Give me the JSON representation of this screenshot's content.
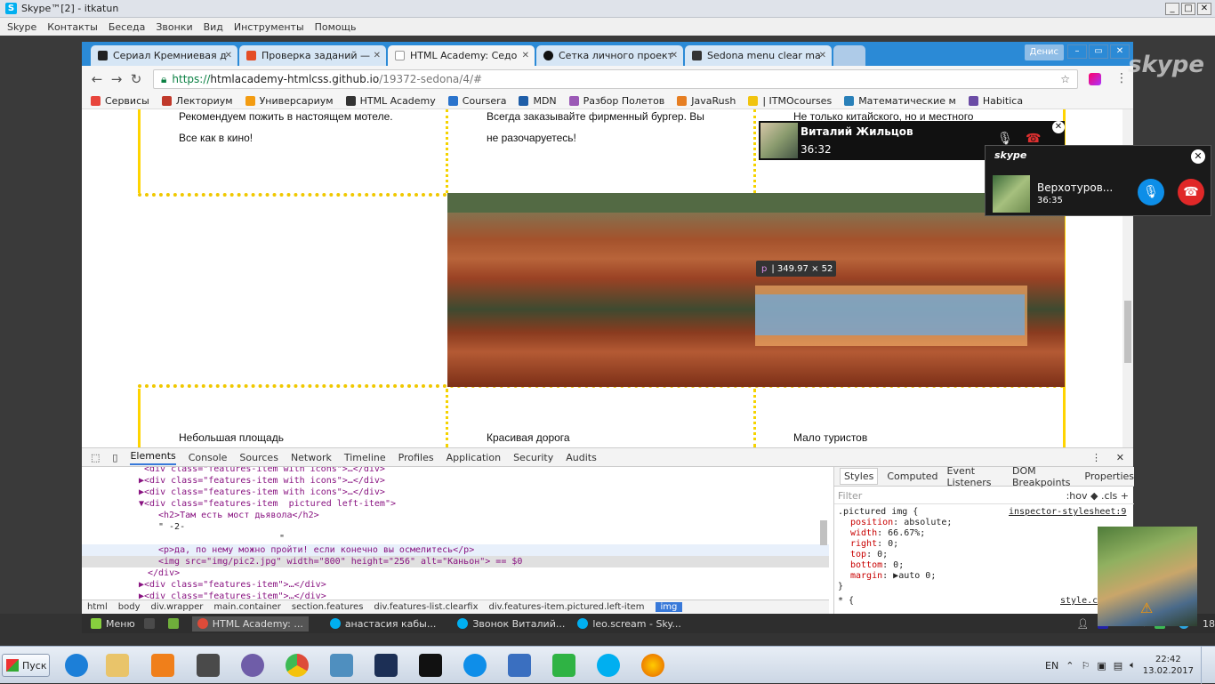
{
  "skype_window": {
    "title": "Skype™[2] - itkatun",
    "menu": [
      "Skype",
      "Контакты",
      "Беседа",
      "Звонки",
      "Вид",
      "Инструменты",
      "Помощь"
    ]
  },
  "browser": {
    "profile": "Денис",
    "tabs": [
      {
        "label": "Сериал Кремниевая д",
        "icon_color": "#222222"
      },
      {
        "label": "Проверка заданий —",
        "icon_color": "#e44d26"
      },
      {
        "label": "HTML Academy: Седо",
        "icon_color": "#555555"
      },
      {
        "label": "Сетка личного проект",
        "icon_color": "#111111"
      },
      {
        "label": "Sedona menu clear ma",
        "icon_color": "#333333"
      }
    ],
    "url": {
      "scheme": "https://",
      "host": "htmlacademy-htmlcss.github.io",
      "path": "/19372-sedona/4/#"
    },
    "bookmarks": [
      {
        "label": "Сервисы",
        "icon_color": "#e8453c"
      },
      {
        "label": "Лекториум",
        "icon_color": "#c0392b"
      },
      {
        "label": "Универсариум",
        "icon_color": "#f39c12"
      },
      {
        "label": "HTML Academy",
        "icon_color": "#333333"
      },
      {
        "label": "Coursera",
        "icon_color": "#2a73cc"
      },
      {
        "label": "MDN",
        "icon_color": "#1f5ea8"
      },
      {
        "label": "Разбор Полетов",
        "icon_color": "#9b59b6"
      },
      {
        "label": "JavaRush",
        "icon_color": "#e67e22"
      },
      {
        "label": "| ITMOcourses",
        "icon_color": "#f1c40f"
      },
      {
        "label": "Математические м",
        "icon_color": "#2980b9"
      },
      {
        "label": "Habitica",
        "icon_color": "#6b4ca5"
      }
    ]
  },
  "page": {
    "col1_text_1": "Рекомендуем пожить в настоящем мотеле.",
    "col1_text_2": "Все как в кино!",
    "col2_text_1": "Всегда заказывайте фирменный бургер. Вы",
    "col2_text_2": "не разочаруетесь!",
    "col3_text_1": "Не только китайского, но и местного",
    "bottom_1": "Небольшая площадь",
    "bottom_2": "Красивая дорога",
    "bottom_3": "Мало туристов",
    "tooltip_tag": "p",
    "tooltip_size": "| 349.97 × 52"
  },
  "devtools": {
    "tabs": [
      "Elements",
      "Console",
      "Sources",
      "Network",
      "Timeline",
      "Profiles",
      "Application",
      "Security",
      "Audits"
    ],
    "elements_lines": [
      "<div class=\"features-item with icons\">…</div>",
      "▶<div class=\"features-item with icons\">…</div>",
      "▶<div class=\"features-item with icons\">…</div>",
      "▼<div class=\"features-item  pictured left-item\">",
      "<h2>Там есть мост дьявола</h2>",
      "\" -2-",
      "\"",
      "<p>да, по нему можно пройти! если конечно вы осмелитесь</p>",
      "<img src=\"img/pic2.jpg\" width=\"800\" height=\"256\" alt=\"Каньон\"> == $0",
      "</div>",
      "▶<div class=\"features-item\">…</div>",
      "▶<div class=\"features-item\">…</div>"
    ],
    "breadcrumbs": [
      "html",
      "body",
      "div.wrapper",
      "main.container",
      "section.features",
      "div.features-list.clearfix",
      "div.features-item.pictured.left-item",
      "img"
    ],
    "styles_tabs": [
      "Styles",
      "Computed",
      "Event Listeners",
      "DOM Breakpoints",
      "Properties"
    ],
    "filter_placeholder": "Filter",
    "filter_tools": ":hov  ◆ .cls  +",
    "rule_selector": ".pictured img {",
    "rule_source": "inspector-stylesheet:9",
    "rule_lines": [
      {
        "prop": "position",
        "val": "absolute;"
      },
      {
        "prop": "width",
        "val": "66.67%;"
      },
      {
        "prop": "right",
        "val": "0;"
      },
      {
        "prop": "top",
        "val": "0;"
      },
      {
        "prop": "bottom",
        "val": "0;"
      },
      {
        "prop": "margin",
        "val": "▶auto 0;"
      }
    ],
    "rule_end": "}",
    "next_rule": "* {",
    "next_source": "style.cs"
  },
  "calls": {
    "call1_name": "Виталий Жильцов",
    "call1_time": "36:32",
    "call2_logo": "skype",
    "call2_name": "Верхотуров...",
    "call2_time": "36:35",
    "watermark": "skype"
  },
  "panel": {
    "menu": "Меню",
    "windows": [
      "HTML Academy: ...",
      "анастасия кабы...",
      "Звонок Виталий...",
      "leo.scream - Sky..."
    ],
    "tray_num": "18"
  },
  "taskbar": {
    "start": "Пуск",
    "lang": "EN",
    "time": "22:42",
    "date": "13.02.2017",
    "apps": [
      {
        "name": "ie",
        "color": "#1c7fd8"
      },
      {
        "name": "explorer",
        "color": "#e9c46a"
      },
      {
        "name": "media",
        "color": "#f07f1a"
      },
      {
        "name": "sublime",
        "color": "#4a4a4a"
      },
      {
        "name": "github",
        "color": "#6f5da8"
      },
      {
        "name": "chrome",
        "color": "#dd4b39"
      },
      {
        "name": "photos",
        "color": "#4f8fbf"
      },
      {
        "name": "photoshop",
        "color": "#1c2f55"
      },
      {
        "name": "cmd",
        "color": "#111111"
      },
      {
        "name": "teamviewer",
        "color": "#0e8ee9"
      },
      {
        "name": "network",
        "color": "#3a6fc0"
      },
      {
        "name": "s-app",
        "color": "#2fb344"
      },
      {
        "name": "skype",
        "color": "#00aff0"
      },
      {
        "name": "firefox",
        "color": "#e66000"
      }
    ]
  }
}
